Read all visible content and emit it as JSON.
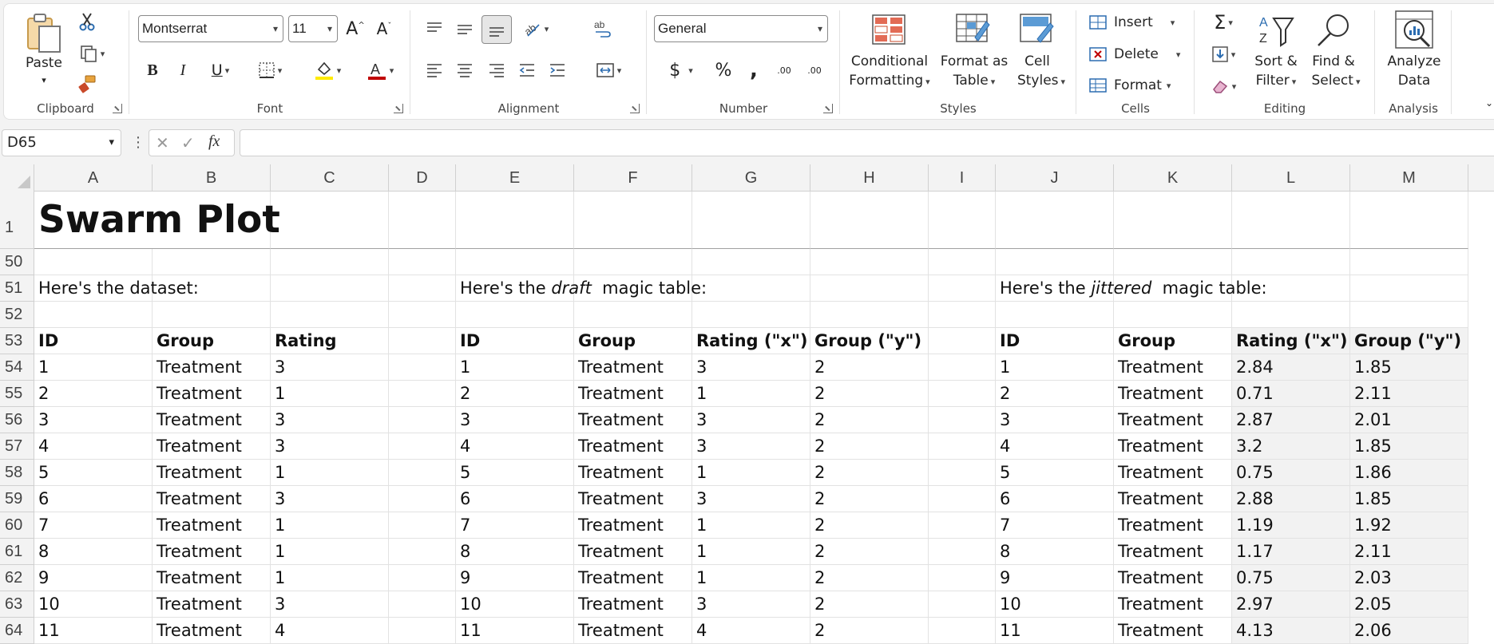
{
  "ribbon": {
    "clipboard": {
      "paste": "Paste",
      "label": "Clipboard"
    },
    "font": {
      "name": "Montserrat",
      "size": "11",
      "label": "Font",
      "bold": "B",
      "italic": "I",
      "underline": "U"
    },
    "alignment": {
      "label": "Alignment"
    },
    "number": {
      "format": "General",
      "label": "Number",
      "currency": "$",
      "percent": "%",
      "comma": ",",
      "inc_decimal": ".00",
      "dec_decimal": ".00"
    },
    "styles": {
      "label": "Styles",
      "conditional_formatting_line1": "Conditional",
      "conditional_formatting_line2": "Formatting",
      "format_as_table_line1": "Format as",
      "format_as_table_line2": "Table",
      "cell_styles_line1": "Cell",
      "cell_styles_line2": "Styles"
    },
    "cells": {
      "label": "Cells",
      "insert": "Insert",
      "delete": "Delete",
      "format": "Format"
    },
    "editing": {
      "label": "Editing",
      "sort_filter_line1": "Sort &",
      "sort_filter_line2": "Filter",
      "find_select_line1": "Find &",
      "find_select_line2": "Select"
    },
    "analysis": {
      "label": "Analysis",
      "analyze_line1": "Analyze",
      "analyze_line2": "Data"
    }
  },
  "formula_bar": {
    "name_box": "D65",
    "formula": ""
  },
  "columns": [
    "A",
    "B",
    "C",
    "D",
    "E",
    "F",
    "G",
    "H",
    "I",
    "J",
    "K",
    "L",
    "M"
  ],
  "title_row": {
    "row": "1",
    "title": "Swarm Plot"
  },
  "rows": [
    {
      "n": "50",
      "cells": {}
    },
    {
      "n": "51",
      "cells": {}
    },
    {
      "n": "52",
      "cells": {}
    },
    {
      "n": "53",
      "cells": {}
    }
  ],
  "sections": {
    "dataset": "Here's the dataset:",
    "draft_prefix": "Here's the ",
    "draft_italic": "draft",
    "draft_suffix": "  magic table:",
    "jittered_prefix": "Here's the ",
    "jittered_italic": "jittered",
    "jittered_suffix": "  magic table:"
  },
  "headers": {
    "dataset": [
      "ID",
      "Group",
      "Rating"
    ],
    "draft": [
      "ID",
      "Group",
      "Rating (\"x\")",
      "Group (\"y\")"
    ],
    "jittered": [
      "ID",
      "Group",
      "Rating (\"x\")",
      "Group (\"y\")"
    ]
  },
  "data_rows": [
    {
      "n": "54",
      "id": "1",
      "group": "Treatment",
      "rating": "3",
      "dx": "3",
      "dy": "2",
      "jx": "2.84",
      "jy": "1.85"
    },
    {
      "n": "55",
      "id": "2",
      "group": "Treatment",
      "rating": "1",
      "dx": "1",
      "dy": "2",
      "jx": "0.71",
      "jy": "2.11"
    },
    {
      "n": "56",
      "id": "3",
      "group": "Treatment",
      "rating": "3",
      "dx": "3",
      "dy": "2",
      "jx": "2.87",
      "jy": "2.01"
    },
    {
      "n": "57",
      "id": "4",
      "group": "Treatment",
      "rating": "3",
      "dx": "3",
      "dy": "2",
      "jx": "3.2",
      "jy": "1.85"
    },
    {
      "n": "58",
      "id": "5",
      "group": "Treatment",
      "rating": "1",
      "dx": "1",
      "dy": "2",
      "jx": "0.75",
      "jy": "1.86"
    },
    {
      "n": "59",
      "id": "6",
      "group": "Treatment",
      "rating": "3",
      "dx": "3",
      "dy": "2",
      "jx": "2.88",
      "jy": "1.85"
    },
    {
      "n": "60",
      "id": "7",
      "group": "Treatment",
      "rating": "1",
      "dx": "1",
      "dy": "2",
      "jx": "1.19",
      "jy": "1.92"
    },
    {
      "n": "61",
      "id": "8",
      "group": "Treatment",
      "rating": "1",
      "dx": "1",
      "dy": "2",
      "jx": "1.17",
      "jy": "2.11"
    },
    {
      "n": "62",
      "id": "9",
      "group": "Treatment",
      "rating": "1",
      "dx": "1",
      "dy": "2",
      "jx": "0.75",
      "jy": "2.03"
    },
    {
      "n": "63",
      "id": "10",
      "group": "Treatment",
      "rating": "3",
      "dx": "3",
      "dy": "2",
      "jx": "2.97",
      "jy": "2.05"
    },
    {
      "n": "64",
      "id": "11",
      "group": "Treatment",
      "rating": "4",
      "dx": "4",
      "dy": "2",
      "jx": "4.13",
      "jy": "2.06"
    }
  ]
}
